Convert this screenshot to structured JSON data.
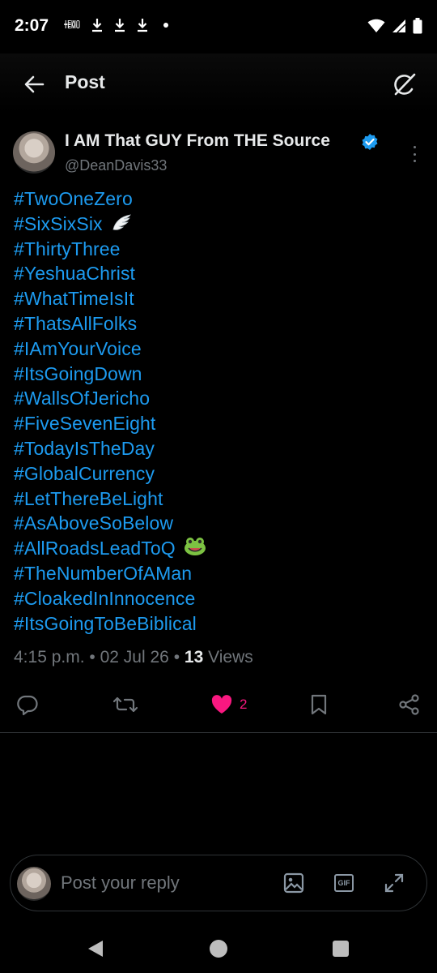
{
  "status_bar": {
    "time": "2:07",
    "temu_label_top": "TEMU",
    "temu_label_bottom": "TEMU",
    "icons": [
      "temu-icon",
      "download-icon",
      "download-icon",
      "download-icon",
      "dot-icon",
      "wifi-icon",
      "signal-icon",
      "battery-icon"
    ]
  },
  "header": {
    "title": "Post",
    "back_icon": "arrow-left-icon",
    "grok_icon": "grok-icon"
  },
  "author": {
    "name": "I AM That GUY From THE Source",
    "handle": "@DeanDavis33",
    "verified": true
  },
  "tweet": {
    "hashtags": [
      "#TwoOneZero",
      "#SixSixSix",
      "#ThirtyThree",
      "#YeshuaChrist",
      "#WhatTimeIsIt",
      "#ThatsAllFolks",
      "#IAmYourVoice",
      "#ItsGoingDown",
      "#WallsOfJericho",
      "#FiveSevenEight",
      "#TodayIsTheDay",
      "#GlobalCurrency",
      "#LetThereBeLight",
      "#AsAboveSoBelow",
      "#AllRoadsLeadToQ",
      "#TheNumberOfAMan",
      "#CloakedInInnocence",
      "#ItsGoingToBeBiblical"
    ],
    "emoji_wing": "🪽",
    "emoji_frog": "🐸",
    "time": "4:15 p.m.",
    "sep1": "•",
    "date": "02 Jul 26",
    "sep2": "•",
    "views_count": "13",
    "views_label": "Views"
  },
  "actions": {
    "like_count": "2"
  },
  "reply": {
    "placeholder": "Post your reply",
    "gif_label": "GIF"
  },
  "colors": {
    "accent": "#1d9bf0",
    "like": "#f91880",
    "muted": "#71767b",
    "text": "#e7e9ea"
  }
}
